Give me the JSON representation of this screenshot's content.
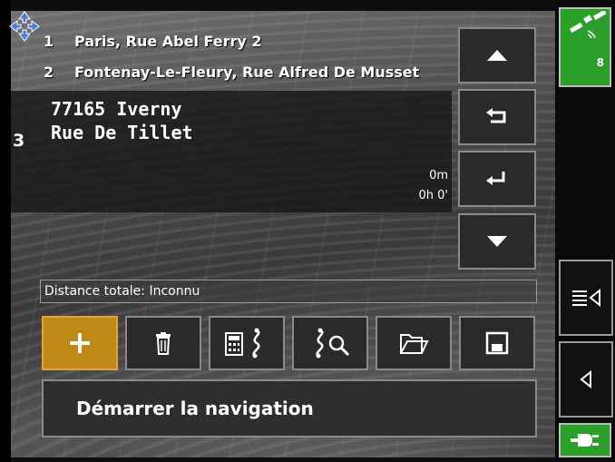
{
  "route": {
    "items": [
      {
        "number": "1",
        "label": "Paris, Rue Abel Ferry 2"
      },
      {
        "number": "2",
        "label": "Fontenay-Le-Fleury, Rue Alfred De Musset"
      }
    ],
    "destination": {
      "number": "3",
      "line1": "77165 Iverny",
      "line2": "Rue De Tillet",
      "distance": "0m",
      "time": "0h 0'"
    },
    "total_distance": "Distance totale: Inconnu"
  },
  "actions": {
    "start_navigation": "Démarrer la navigation"
  },
  "status": {
    "satellite_count": "8"
  },
  "icons": {
    "nav": "nav-arrows-icon",
    "up": "triangle-up-icon",
    "back": "return-left-icon",
    "enter": "enter-icon",
    "down": "triangle-down-icon",
    "add": "plus-icon",
    "delete": "trash-icon",
    "calc_route": "calculator-route-icon",
    "search_route": "route-search-icon",
    "open": "folder-open-icon",
    "save": "save-icon",
    "satellite": "satellite-icon",
    "menu": "menu-list-icon",
    "collapse": "triangle-left-icon",
    "power": "plug-icon"
  },
  "colors": {
    "accent": "#c08a18",
    "gps_green": "#2aa02a",
    "button_bg": "#2a2a2a",
    "button_border": "#8a8a8a"
  }
}
